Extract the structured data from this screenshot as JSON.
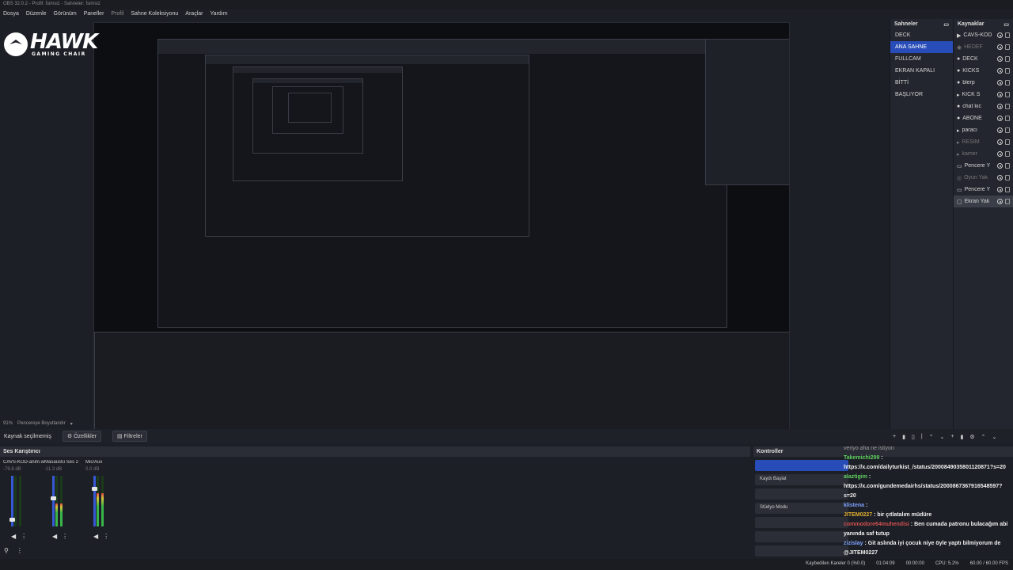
{
  "window": {
    "title": "OBS 32.0.2 - Profil: İsimsiz - Sahneler: İsimsiz"
  },
  "menu": [
    "Dosya",
    "Düzenle",
    "Görünüm",
    "Paneller",
    "Profil",
    "Sahne Koleksiyonu",
    "Araçlar",
    "Yardım"
  ],
  "logo": {
    "brand": "HAWK",
    "tagline": "GAMING CHAIR"
  },
  "scenes": {
    "title": "Sahneler",
    "items": [
      "DECK",
      "ANA SAHNE",
      "FULLCAM",
      "EKRAN KAPALI",
      "BİTTİ",
      "BAŞLIYOR"
    ],
    "active_index": 1
  },
  "sources": {
    "title": "Kaynaklar",
    "items": [
      {
        "name": "CAVS-KOD",
        "icon": "play-icon",
        "dim": false
      },
      {
        "name": "HEDEF",
        "icon": "camera-icon",
        "dim": true
      },
      {
        "name": "DECK",
        "icon": "image-icon",
        "dim": false
      },
      {
        "name": "KİCKS",
        "icon": "image-icon",
        "dim": false
      },
      {
        "name": "blerp",
        "icon": "image-icon",
        "dim": false
      },
      {
        "name": "KİCK S",
        "icon": "folder-icon",
        "dim": false
      },
      {
        "name": "chat kic",
        "icon": "image-icon",
        "dim": false
      },
      {
        "name": "ABONE",
        "icon": "image-icon",
        "dim": false
      },
      {
        "name": "paracı",
        "icon": "folder-icon",
        "dim": false
      },
      {
        "name": "RESİM",
        "icon": "folder-icon",
        "dim": true
      },
      {
        "name": "kamer",
        "icon": "folder-icon",
        "dim": true
      },
      {
        "name": "Pencere Y",
        "icon": "window-icon",
        "dim": false
      },
      {
        "name": "Oyun Yak",
        "icon": "gamepad-icon",
        "dim": true
      },
      {
        "name": "Pencere Y",
        "icon": "window-icon",
        "dim": false
      },
      {
        "name": "Ekran Yak",
        "icon": "monitor-icon",
        "dim": false
      }
    ]
  },
  "zoom": {
    "value": "91%",
    "label": "Pencereye Boyutlandır"
  },
  "source_bar": {
    "no_selection": "Kaynak seçilmemiş",
    "properties_label": "Özellikler",
    "filters_label": "Filtreler"
  },
  "mixer": {
    "title": "Ses Karıştırıcı",
    "channels": [
      {
        "name": "CAVS-KOD-anim.w",
        "db": "-79.8 dB",
        "level": 0.0,
        "fader": 0.1
      },
      {
        "name": "Masaüstü Ses 2",
        "db": "-11.3 dB",
        "level": 0.45,
        "fader": 0.55
      },
      {
        "name": "Mic/Aux",
        "db": "0.0 dB",
        "level": 0.65,
        "fader": 0.75
      }
    ]
  },
  "controls": {
    "title": "Kontroller",
    "buttons": [
      "",
      "Kaydı Başlat",
      "",
      "Stüdyo Modu",
      "",
      "",
      ""
    ]
  },
  "chat": [
    {
      "user": "",
      "text": "veriyo aha ne istiyon",
      "user_color": "",
      "faded": true
    },
    {
      "user": "Takemichi299",
      "text": "https://x.com/dailyturkist_/status/2000849035801120871?s=20",
      "user_color": "green"
    },
    {
      "user": "alaztigim",
      "text": "https://x.com/gundemedairhs/status/2000867367916548597?s=20",
      "user_color": "green"
    },
    {
      "user": "klistena",
      "text": "",
      "user_color": "blue"
    },
    {
      "user": "JITEM0227",
      "text": "bir çıtlatalım müdüre",
      "user_color": "yellow"
    },
    {
      "user": "commodore64muhendisi",
      "text": "Ben cumada patronu bulacağım abi yanında saf tutup",
      "user_color": "red"
    },
    {
      "user": "zizislay",
      "text": "Git aslında iyi çocuk niye öyle yaptı bilmiyorum de @JITEM0227",
      "user_color": "blue"
    }
  ],
  "status": {
    "dropped": "Kaybedilen Kareler 0 (%0.0)",
    "cpu": "CPU: 5.2%",
    "fps": "60.00 / 60.00 FPS",
    "rec_time": "00:00:00",
    "live_time": "01:04:09"
  }
}
